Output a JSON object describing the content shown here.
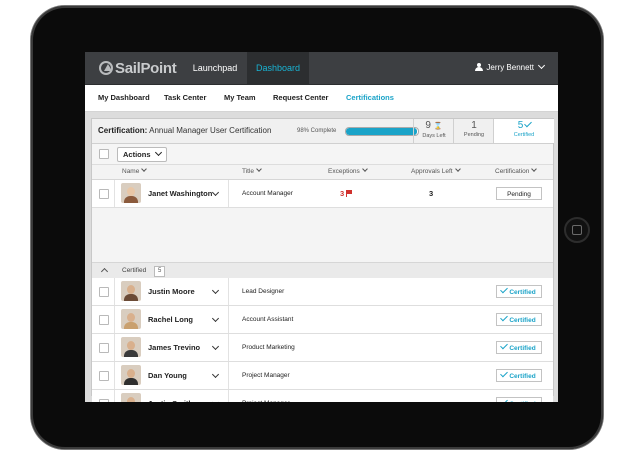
{
  "topbar": {
    "logo": "SailPoint",
    "nav": [
      "Launchpad",
      "Dashboard"
    ],
    "active_nav": "Dashboard",
    "user": "Jerry Bennett"
  },
  "tabs": {
    "items": [
      "My Dashboard",
      "Task Center",
      "My Team",
      "Request Center",
      "Certifications"
    ],
    "active": "Certifications"
  },
  "certification": {
    "label": "Certification:",
    "name": "Annual Manager User Certification",
    "percent_text": "98% Complete",
    "percent_value": 98,
    "stats": [
      {
        "num": "9",
        "label": "Days Left"
      },
      {
        "num": "1",
        "label": "Pending"
      },
      {
        "num": "5",
        "label": "Certified"
      }
    ]
  },
  "actions": {
    "label": "Actions"
  },
  "columns": [
    "Name",
    "Title",
    "Exceptions",
    "Approvals Left",
    "Certification"
  ],
  "pending_rows": [
    {
      "name": "Janet Washington",
      "title": "Account Manager",
      "exceptions": "3",
      "approvals": "3",
      "status": "Pending"
    }
  ],
  "group": {
    "label": "Certified",
    "count": "5"
  },
  "certified_rows": [
    {
      "name": "Justin Moore",
      "title": "Lead Designer",
      "status": "Certified"
    },
    {
      "name": "Rachel Long",
      "title": "Account Assistant",
      "status": "Certified"
    },
    {
      "name": "James Trevino",
      "title": "Product Marketing",
      "status": "Certified"
    },
    {
      "name": "Dan Young",
      "title": "Project Manager",
      "status": "Certified"
    },
    {
      "name": "Justin Smith",
      "title": "Project Manager",
      "status": "Certified"
    }
  ],
  "colors": {
    "accent": "#1aa3c8",
    "topbar": "#3d3f42",
    "exception": "#d0312d"
  }
}
